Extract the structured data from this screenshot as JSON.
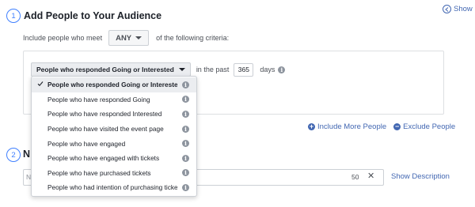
{
  "show_link": "Show",
  "section1": {
    "number": "1",
    "title": "Add People to Your Audience",
    "criteria_prefix": "Include people who meet",
    "match_value": "ANY",
    "criteria_suffix": "of the following criteria:"
  },
  "rule": {
    "selected": "People who responded Going or Interested",
    "past_label": "in the past",
    "days_value": "365",
    "days_label": "days"
  },
  "dropdown": {
    "options": [
      "People who responded Going or Interested",
      "People who have responded Going",
      "People who have responded Interested",
      "People who have visited the event page",
      "People who have engaged",
      "People who have engaged with tickets",
      "People who have purchased tickets",
      "People who had intention of purchasing tickets"
    ]
  },
  "actions": {
    "include": "Include More People",
    "exclude": "Exclude People"
  },
  "section2": {
    "number": "2",
    "title_partial": "N",
    "input_partial": "N",
    "char_count": "50",
    "clear": "✕",
    "show_description": "Show Description"
  },
  "icons": {
    "info": "i",
    "plus": "+",
    "minus": "−"
  },
  "colors": {
    "accent": "#4267b2",
    "step_circle": "#4080ff",
    "selected_bg": "#ebedf0",
    "info_icon": "#8d949e"
  }
}
